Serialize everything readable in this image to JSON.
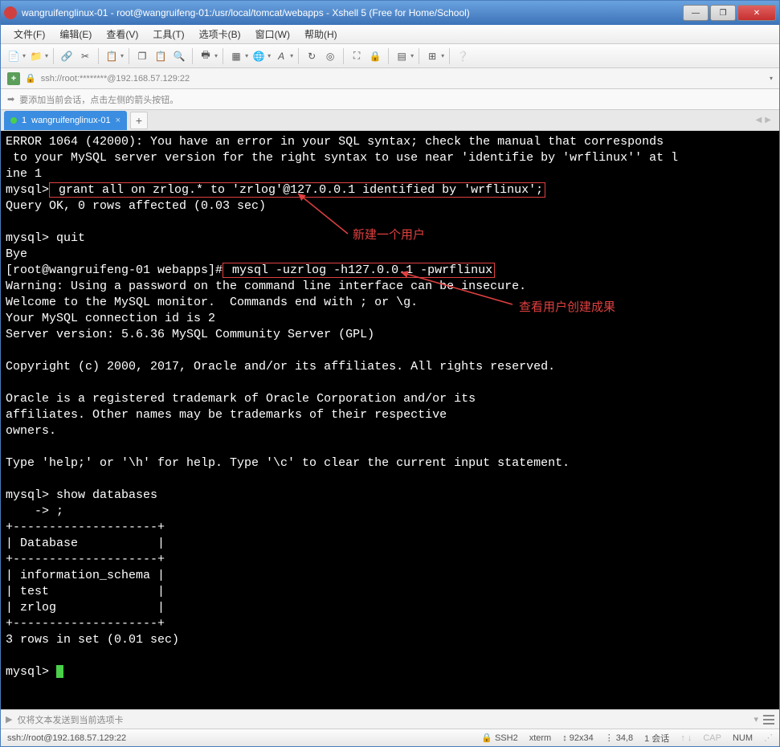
{
  "titlebar": {
    "text": "wangruifenglinux-01 - root@wangruifeng-01:/usr/local/tomcat/webapps - Xshell 5 (Free for Home/School)"
  },
  "menu": {
    "file": "文件(F)",
    "edit": "编辑(E)",
    "view": "查看(V)",
    "tools": "工具(T)",
    "tabs": "选项卡(B)",
    "window": "窗口(W)",
    "help": "帮助(H)"
  },
  "addressbar": {
    "url": "ssh://root:********@192.168.57.129:22"
  },
  "hintbar": {
    "text": "要添加当前会话，点击左侧的箭头按钮。"
  },
  "tab": {
    "index": "1",
    "name": "wangruifenglinux-01"
  },
  "annotations": {
    "a1": "新建一个用户",
    "a2": "查看用户创建成果"
  },
  "term": {
    "l1": "ERROR 1064 (42000): You have an error in your SQL syntax; check the manual that corresponds",
    "l2": " to your MySQL server version for the right syntax to use near 'identifie by 'wrflinux'' at l",
    "l3": "ine 1",
    "l4a": "mysql>",
    "l4b": " grant all on zrlog.* to 'zrlog'@127.0.0.1 identified by 'wrflinux';",
    "l5": "Query OK, 0 rows affected (0.03 sec)",
    "l6": "",
    "l7": "mysql> quit",
    "l8": "Bye",
    "l9a": "[root@wangruifeng-01 webapps]#",
    "l9b": " mysql -uzrlog -h127.0.0.1 -pwrflinux",
    "l10": "Warning: Using a password on the command line interface can be insecure.",
    "l11": "Welcome to the MySQL monitor.  Commands end with ; or \\g.",
    "l12": "Your MySQL connection id is 2",
    "l13": "Server version: 5.6.36 MySQL Community Server (GPL)",
    "l14": "",
    "l15": "Copyright (c) 2000, 2017, Oracle and/or its affiliates. All rights reserved.",
    "l16": "",
    "l17": "Oracle is a registered trademark of Oracle Corporation and/or its",
    "l18": "affiliates. Other names may be trademarks of their respective",
    "l19": "owners.",
    "l20": "",
    "l21": "Type 'help;' or '\\h' for help. Type '\\c' to clear the current input statement.",
    "l22": "",
    "l23": "mysql> show databases",
    "l24": "    -> ;",
    "l25": "+--------------------+",
    "l26": "| Database           |",
    "l27": "+--------------------+",
    "l28": "| information_schema |",
    "l29": "| test               |",
    "l30": "| zrlog              |",
    "l31": "+--------------------+",
    "l32": "3 rows in set (0.01 sec)",
    "l33": "",
    "l34": "mysql> "
  },
  "inputbar": {
    "placeholder": "仅将文本发送到当前选项卡"
  },
  "statusbar": {
    "conn": "ssh://root@192.168.57.129:22",
    "proto": "SSH2",
    "termtype": "xterm",
    "size": "92x34",
    "pos": "34,8",
    "sessions": "1 会话",
    "caps": "CAP",
    "num": "NUM"
  }
}
